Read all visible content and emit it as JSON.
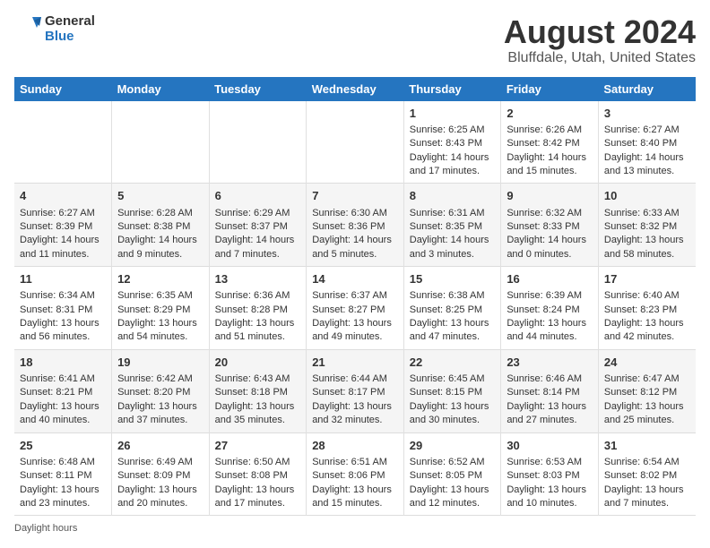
{
  "logo": {
    "text_general": "General",
    "text_blue": "Blue"
  },
  "header": {
    "title": "August 2024",
    "subtitle": "Bluffdale, Utah, United States"
  },
  "days_of_week": [
    "Sunday",
    "Monday",
    "Tuesday",
    "Wednesday",
    "Thursday",
    "Friday",
    "Saturday"
  ],
  "footer": {
    "note": "Daylight hours"
  },
  "weeks": [
    {
      "days": [
        {
          "num": "",
          "sunrise": "",
          "sunset": "",
          "daylight": ""
        },
        {
          "num": "",
          "sunrise": "",
          "sunset": "",
          "daylight": ""
        },
        {
          "num": "",
          "sunrise": "",
          "sunset": "",
          "daylight": ""
        },
        {
          "num": "",
          "sunrise": "",
          "sunset": "",
          "daylight": ""
        },
        {
          "num": "1",
          "sunrise": "Sunrise: 6:25 AM",
          "sunset": "Sunset: 8:43 PM",
          "daylight": "Daylight: 14 hours and 17 minutes."
        },
        {
          "num": "2",
          "sunrise": "Sunrise: 6:26 AM",
          "sunset": "Sunset: 8:42 PM",
          "daylight": "Daylight: 14 hours and 15 minutes."
        },
        {
          "num": "3",
          "sunrise": "Sunrise: 6:27 AM",
          "sunset": "Sunset: 8:40 PM",
          "daylight": "Daylight: 14 hours and 13 minutes."
        }
      ]
    },
    {
      "days": [
        {
          "num": "4",
          "sunrise": "Sunrise: 6:27 AM",
          "sunset": "Sunset: 8:39 PM",
          "daylight": "Daylight: 14 hours and 11 minutes."
        },
        {
          "num": "5",
          "sunrise": "Sunrise: 6:28 AM",
          "sunset": "Sunset: 8:38 PM",
          "daylight": "Daylight: 14 hours and 9 minutes."
        },
        {
          "num": "6",
          "sunrise": "Sunrise: 6:29 AM",
          "sunset": "Sunset: 8:37 PM",
          "daylight": "Daylight: 14 hours and 7 minutes."
        },
        {
          "num": "7",
          "sunrise": "Sunrise: 6:30 AM",
          "sunset": "Sunset: 8:36 PM",
          "daylight": "Daylight: 14 hours and 5 minutes."
        },
        {
          "num": "8",
          "sunrise": "Sunrise: 6:31 AM",
          "sunset": "Sunset: 8:35 PM",
          "daylight": "Daylight: 14 hours and 3 minutes."
        },
        {
          "num": "9",
          "sunrise": "Sunrise: 6:32 AM",
          "sunset": "Sunset: 8:33 PM",
          "daylight": "Daylight: 14 hours and 0 minutes."
        },
        {
          "num": "10",
          "sunrise": "Sunrise: 6:33 AM",
          "sunset": "Sunset: 8:32 PM",
          "daylight": "Daylight: 13 hours and 58 minutes."
        }
      ]
    },
    {
      "days": [
        {
          "num": "11",
          "sunrise": "Sunrise: 6:34 AM",
          "sunset": "Sunset: 8:31 PM",
          "daylight": "Daylight: 13 hours and 56 minutes."
        },
        {
          "num": "12",
          "sunrise": "Sunrise: 6:35 AM",
          "sunset": "Sunset: 8:29 PM",
          "daylight": "Daylight: 13 hours and 54 minutes."
        },
        {
          "num": "13",
          "sunrise": "Sunrise: 6:36 AM",
          "sunset": "Sunset: 8:28 PM",
          "daylight": "Daylight: 13 hours and 51 minutes."
        },
        {
          "num": "14",
          "sunrise": "Sunrise: 6:37 AM",
          "sunset": "Sunset: 8:27 PM",
          "daylight": "Daylight: 13 hours and 49 minutes."
        },
        {
          "num": "15",
          "sunrise": "Sunrise: 6:38 AM",
          "sunset": "Sunset: 8:25 PM",
          "daylight": "Daylight: 13 hours and 47 minutes."
        },
        {
          "num": "16",
          "sunrise": "Sunrise: 6:39 AM",
          "sunset": "Sunset: 8:24 PM",
          "daylight": "Daylight: 13 hours and 44 minutes."
        },
        {
          "num": "17",
          "sunrise": "Sunrise: 6:40 AM",
          "sunset": "Sunset: 8:23 PM",
          "daylight": "Daylight: 13 hours and 42 minutes."
        }
      ]
    },
    {
      "days": [
        {
          "num": "18",
          "sunrise": "Sunrise: 6:41 AM",
          "sunset": "Sunset: 8:21 PM",
          "daylight": "Daylight: 13 hours and 40 minutes."
        },
        {
          "num": "19",
          "sunrise": "Sunrise: 6:42 AM",
          "sunset": "Sunset: 8:20 PM",
          "daylight": "Daylight: 13 hours and 37 minutes."
        },
        {
          "num": "20",
          "sunrise": "Sunrise: 6:43 AM",
          "sunset": "Sunset: 8:18 PM",
          "daylight": "Daylight: 13 hours and 35 minutes."
        },
        {
          "num": "21",
          "sunrise": "Sunrise: 6:44 AM",
          "sunset": "Sunset: 8:17 PM",
          "daylight": "Daylight: 13 hours and 32 minutes."
        },
        {
          "num": "22",
          "sunrise": "Sunrise: 6:45 AM",
          "sunset": "Sunset: 8:15 PM",
          "daylight": "Daylight: 13 hours and 30 minutes."
        },
        {
          "num": "23",
          "sunrise": "Sunrise: 6:46 AM",
          "sunset": "Sunset: 8:14 PM",
          "daylight": "Daylight: 13 hours and 27 minutes."
        },
        {
          "num": "24",
          "sunrise": "Sunrise: 6:47 AM",
          "sunset": "Sunset: 8:12 PM",
          "daylight": "Daylight: 13 hours and 25 minutes."
        }
      ]
    },
    {
      "days": [
        {
          "num": "25",
          "sunrise": "Sunrise: 6:48 AM",
          "sunset": "Sunset: 8:11 PM",
          "daylight": "Daylight: 13 hours and 23 minutes."
        },
        {
          "num": "26",
          "sunrise": "Sunrise: 6:49 AM",
          "sunset": "Sunset: 8:09 PM",
          "daylight": "Daylight: 13 hours and 20 minutes."
        },
        {
          "num": "27",
          "sunrise": "Sunrise: 6:50 AM",
          "sunset": "Sunset: 8:08 PM",
          "daylight": "Daylight: 13 hours and 17 minutes."
        },
        {
          "num": "28",
          "sunrise": "Sunrise: 6:51 AM",
          "sunset": "Sunset: 8:06 PM",
          "daylight": "Daylight: 13 hours and 15 minutes."
        },
        {
          "num": "29",
          "sunrise": "Sunrise: 6:52 AM",
          "sunset": "Sunset: 8:05 PM",
          "daylight": "Daylight: 13 hours and 12 minutes."
        },
        {
          "num": "30",
          "sunrise": "Sunrise: 6:53 AM",
          "sunset": "Sunset: 8:03 PM",
          "daylight": "Daylight: 13 hours and 10 minutes."
        },
        {
          "num": "31",
          "sunrise": "Sunrise: 6:54 AM",
          "sunset": "Sunset: 8:02 PM",
          "daylight": "Daylight: 13 hours and 7 minutes."
        }
      ]
    }
  ]
}
